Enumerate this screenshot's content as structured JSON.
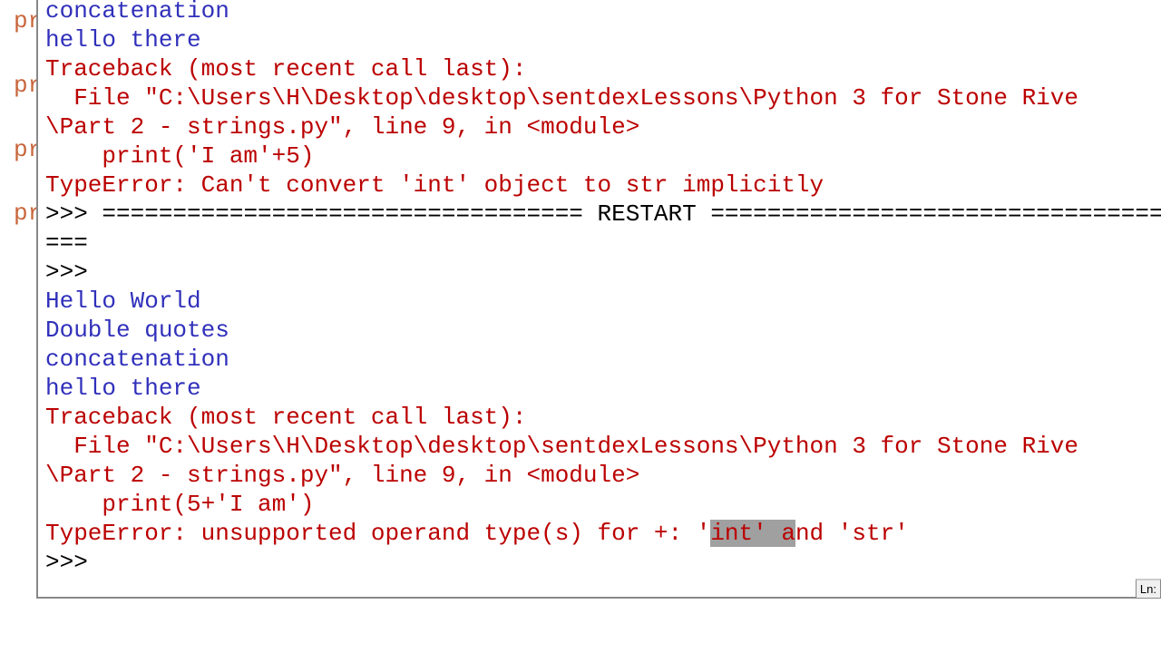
{
  "editor_behind": {
    "lines": [
      "pr",
      "pr",
      "pr",
      "pr"
    ]
  },
  "shell": {
    "run1": {
      "out1": "concatenation",
      "out2": "hello there",
      "tb1": "Traceback (most recent call last):",
      "tb2": "  File \"C:\\Users\\H\\Desktop\\desktop\\sentdexLessons\\Python 3 for Stone Rive",
      "tb3": "\\Part 2 - strings.py\", line 9, in <module>",
      "tb4": "    print('I am'+5)",
      "tb5": "TypeError: Can't convert 'int' object to str implicitly"
    },
    "restart": {
      "line1_prompt": ">>> ",
      "line1_rest": "================================== RESTART ==================================",
      "line2": "==="
    },
    "prompt_empty": ">>> ",
    "run2": {
      "out1": "Hello World",
      "out2": "Double quotes",
      "out3": "concatenation",
      "out4": "hello there",
      "tb1": "Traceback (most recent call last):",
      "tb2": "  File \"C:\\Users\\H\\Desktop\\desktop\\sentdexLessons\\Python 3 for Stone Rive",
      "tb3": "\\Part 2 - strings.py\", line 9, in <module>",
      "tb4": "    print(5+'I am')",
      "tb5_pre": "TypeError: unsupported operand type(s) for +: '",
      "tb5_hl": "int' a",
      "tb5_post": "nd 'str'"
    },
    "final_prompt": ">>> "
  },
  "status": {
    "label": "Ln:"
  }
}
